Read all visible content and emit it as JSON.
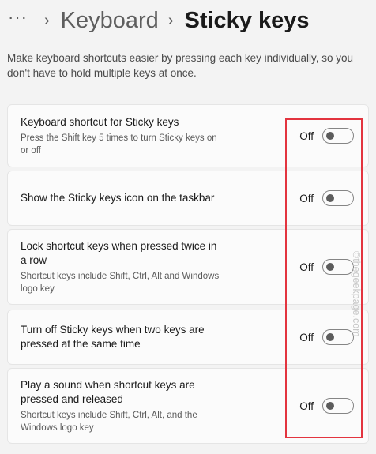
{
  "breadcrumb": {
    "more_label": "···",
    "separator": "›",
    "parent": "Keyboard",
    "current": "Sticky keys"
  },
  "description": "Make keyboard shortcuts easier by pressing each key individually, so you don't have to hold multiple keys at once.",
  "settings": [
    {
      "title": "Keyboard shortcut for Sticky keys",
      "subtitle": "Press the Shift key 5 times to turn Sticky keys on or off",
      "state_label": "Off",
      "enabled": false
    },
    {
      "title": "Show the Sticky keys icon on the taskbar",
      "subtitle": "",
      "state_label": "Off",
      "enabled": false
    },
    {
      "title": "Lock shortcut keys when pressed twice in a row",
      "subtitle": "Shortcut keys include Shift, Ctrl, Alt and Windows logo key",
      "state_label": "Off",
      "enabled": false
    },
    {
      "title": "Turn off Sticky keys when two keys are pressed at the same time",
      "subtitle": "",
      "state_label": "Off",
      "enabled": false
    },
    {
      "title": "Play a sound when shortcut keys are pressed and released",
      "subtitle": "Shortcut keys include Shift, Ctrl, Alt, and the Windows logo key",
      "state_label": "Off",
      "enabled": false
    }
  ],
  "watermark": "©thegeekpage.com",
  "colors": {
    "highlight": "#e3343f",
    "background": "#f3f3f3",
    "card": "#fbfbfb"
  }
}
